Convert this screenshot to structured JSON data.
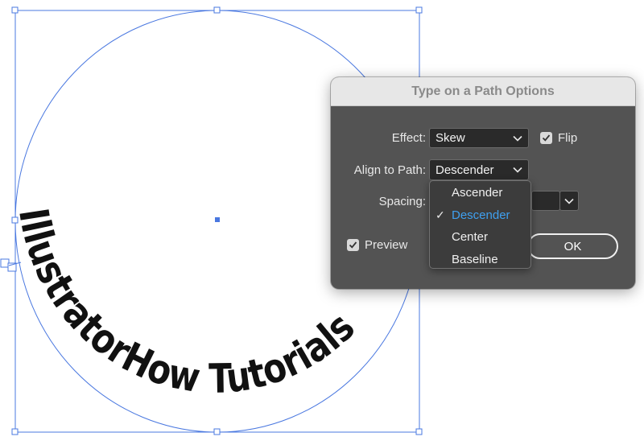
{
  "artboard": {
    "curved_text": "IllustratorHow Tutorials",
    "selection_color": "#4a78e0"
  },
  "dialog": {
    "title": "Type on a Path Options",
    "effect_label": "Effect:",
    "effect_value": "Skew",
    "flip_label": "Flip",
    "flip_checked": true,
    "align_label": "Align to Path:",
    "align_value": "Descender",
    "spacing_label": "Spacing:",
    "preview_label": "Preview",
    "preview_checked": true,
    "ok_label": "OK"
  },
  "align_menu": {
    "items": [
      {
        "label": "Ascender",
        "selected": false
      },
      {
        "label": "Descender",
        "selected": true
      },
      {
        "label": "Center",
        "selected": false
      },
      {
        "label": "Baseline",
        "selected": false
      }
    ],
    "check_glyph": "✓",
    "selected_color": "#3fa0f0"
  }
}
